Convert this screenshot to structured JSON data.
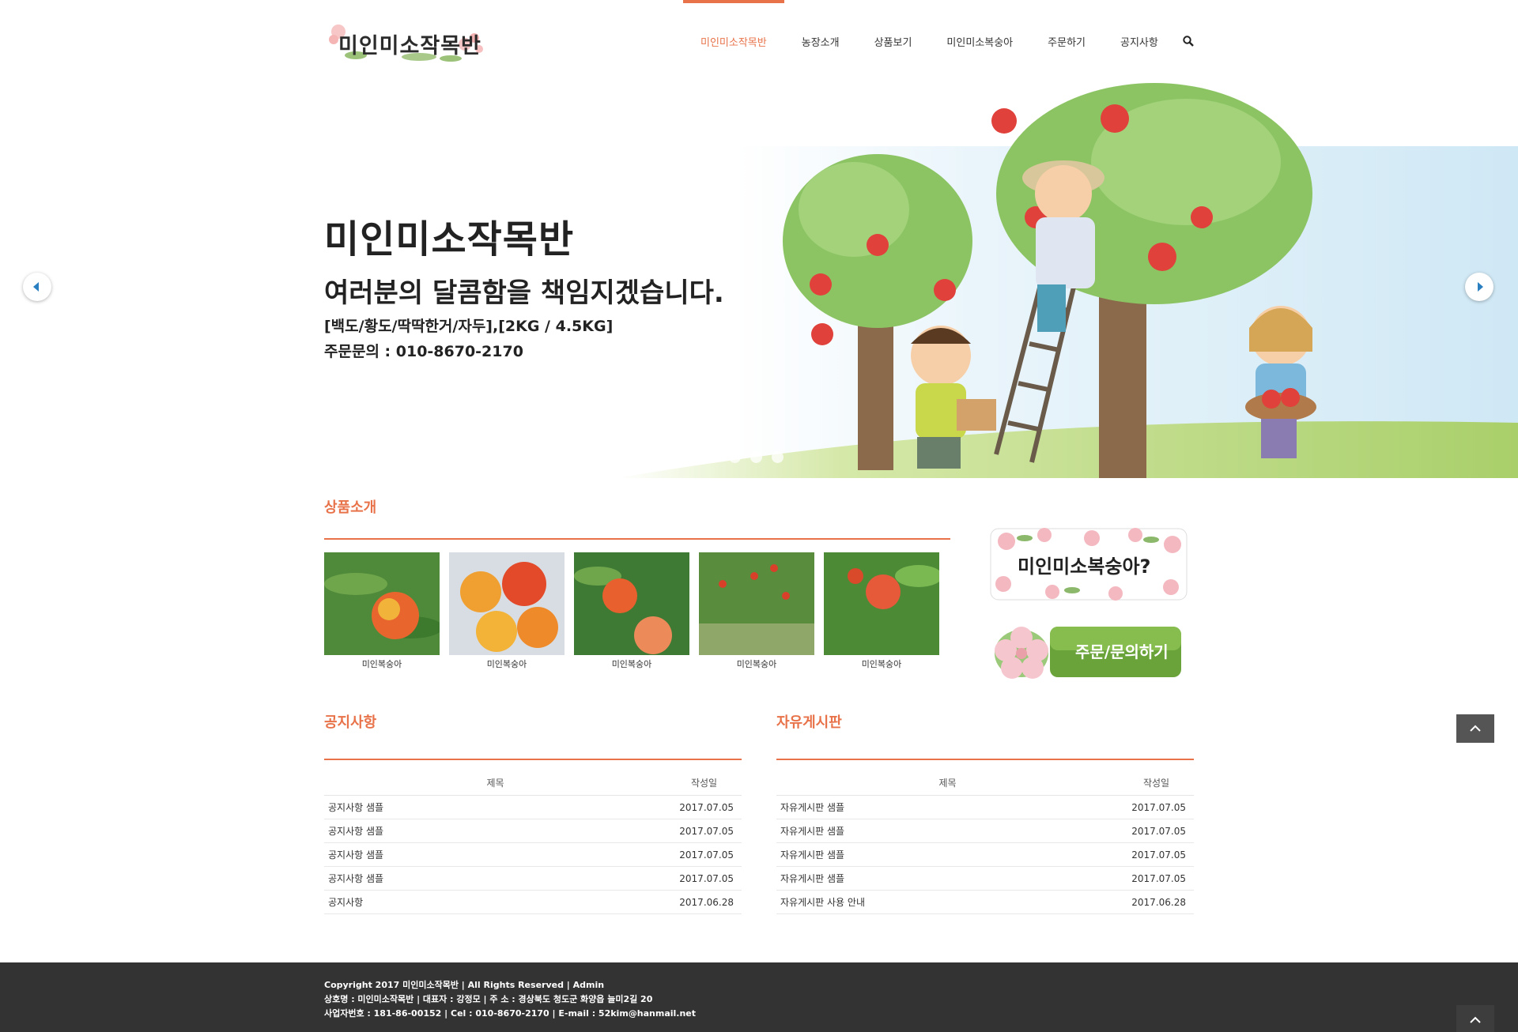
{
  "header": {
    "logo_text": "미인미소작목반",
    "nav": [
      "미인미소작목반",
      "농장소개",
      "상품보기",
      "미인미소복숭아",
      "주문하기",
      "공지사항"
    ],
    "accent": "#e8734a"
  },
  "hero": {
    "title": "미인미소작목반",
    "subtitle": "여러분의 달콤함을 책임지겠습니다.",
    "line3": "[백도/황도/딱딱한거/자두],[2KG / 4.5KG]",
    "line4": "주문문의 : 010-8670-2170",
    "dots": 3
  },
  "products": {
    "title": "상품소개",
    "items": [
      {
        "caption": "미인복숭아"
      },
      {
        "caption": "미인복숭아"
      },
      {
        "caption": "미인복숭아"
      },
      {
        "caption": "미인복숭아"
      },
      {
        "caption": "미인복숭아"
      }
    ]
  },
  "banners": {
    "about": "미인미소복숭아?",
    "order": "주문/문의하기"
  },
  "notice": {
    "title": "공지사항",
    "col_title": "제목",
    "col_date": "작성일",
    "rows": [
      {
        "title": "공지사항 샘플",
        "date": "2017.07.05"
      },
      {
        "title": "공지사항 샘플",
        "date": "2017.07.05"
      },
      {
        "title": "공지사항 샘플",
        "date": "2017.07.05"
      },
      {
        "title": "공지사항 샘플",
        "date": "2017.07.05"
      },
      {
        "title": "공지사항",
        "date": "2017.06.28"
      }
    ]
  },
  "free_board": {
    "title": "자유게시판",
    "col_title": "제목",
    "col_date": "작성일",
    "rows": [
      {
        "title": "자유게시판 샘플",
        "date": "2017.07.05"
      },
      {
        "title": "자유게시판 샘플",
        "date": "2017.07.05"
      },
      {
        "title": "자유게시판 샘플",
        "date": "2017.07.05"
      },
      {
        "title": "자유게시판 샘플",
        "date": "2017.07.05"
      },
      {
        "title": "자유게시판 사용 안내",
        "date": "2017.06.28"
      }
    ]
  },
  "footer": {
    "line1": "Copyright 2017 미인미소작목반 | All Rights Reserved | Admin",
    "line2": "상호명 : 미인미소작목반 | 대표자 : 강정모 | 주 소 : 경상북도 청도군 화양읍 늘미2길 20",
    "line3": "사업자번호 : 181-86-00152 | Cel : 010-8670-2170 | E-mail : 52kim@hanmail.net"
  }
}
